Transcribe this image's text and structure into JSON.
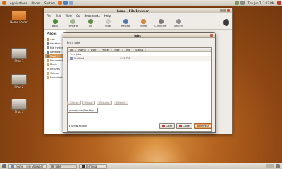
{
  "top_panel": {
    "menus": [
      "Applications",
      "Places",
      "System"
    ],
    "clock": "Thu Jun 7, 1:27 PM"
  },
  "desktop": {
    "icons": [
      {
        "name": "Home Folder"
      },
      {
        "name": "Shot 1"
      },
      {
        "name": "Shot 2"
      },
      {
        "name": "Shot 3"
      }
    ]
  },
  "file_manager": {
    "title": "home - File Browser",
    "menus": [
      "File",
      "Edit",
      "View",
      "Go",
      "Bookmarks",
      "Help"
    ],
    "toolbar": [
      "Back",
      "Forward",
      "Up",
      "Stop",
      "Reload",
      "Home",
      "Computer",
      "Search"
    ],
    "sidebar_title": "Places",
    "sidebar_items": [
      "user",
      "Desktop",
      "File System",
      "Network",
      "Trash",
      "Documents",
      "Music",
      "Pictures",
      "Videos",
      "Downloads"
    ]
  },
  "dialog": {
    "title": "Jobs",
    "heading": "Print Jobs",
    "columns": [
      "Job",
      "Name",
      "User",
      "Printer",
      "Size",
      "Time",
      "Status"
    ],
    "rows": [
      {
        "name": "Untitled",
        "time": "1:27 PM"
      }
    ],
    "action_buttons": [
      "Cancel",
      "Pause",
      "Resume",
      "Reprint"
    ],
    "filename": "/home/user/Desktop",
    "footer_check": "Show all jobs",
    "buttons": {
      "clear": "Clear",
      "close": "Close",
      "refresh": "Refresh"
    }
  },
  "taskbar": {
    "items": [
      "home - File Browser",
      "Jobs",
      "Terminal"
    ]
  }
}
